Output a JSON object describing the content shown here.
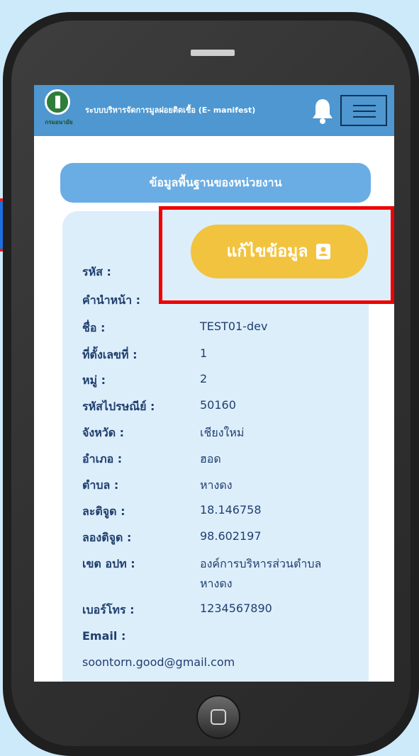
{
  "header": {
    "app_title": "ระบบบริหารจัดการมูลฝอยติดเชื้อ (E- manifest)",
    "logo_caption": "กรมอนามัย"
  },
  "section": {
    "title": "ข้อมูลพื้นฐานของหน่วยงาน"
  },
  "edit_button": {
    "label": "แก้ไขข้อมูล"
  },
  "fields": [
    {
      "label": "รหัส :",
      "value": ""
    },
    {
      "label": "คำนำหน้า :",
      "value": ""
    },
    {
      "label": "ชื่อ :",
      "value": "TEST01-dev"
    },
    {
      "label": "ที่ตั้งเลขที่ :",
      "value": "1"
    },
    {
      "label": "หมู่ :",
      "value": "2"
    },
    {
      "label": "รหัสไปรษณีย์ :",
      "value": "50160"
    },
    {
      "label": "จังหวัด :",
      "value": "เชียงใหม่"
    },
    {
      "label": "อำเภอ :",
      "value": "ฮอด"
    },
    {
      "label": "ตำบล :",
      "value": "หางดง"
    },
    {
      "label": "ละติจูด :",
      "value": "18.146758"
    },
    {
      "label": "ลองติจูด :",
      "value": "98.602197"
    },
    {
      "label": "เขต อปท :",
      "value": "องค์การบริหารส่วนตำบล",
      "value_line2": "หางดง"
    },
    {
      "label": "เบอร์โทร :",
      "value": "1234567890"
    },
    {
      "label": "Email :",
      "value": ""
    }
  ],
  "email_value": "soontorn.good@gmail.com",
  "colors": {
    "background": "#cdeafb",
    "topbar": "#4e97d0",
    "section_pill": "#6aade4",
    "content_box": "#ddeefb",
    "edit_button": "#f2c33e",
    "highlight": "#ee0202",
    "text": "#1f3f6e"
  },
  "icons": {
    "notification": "bell-icon",
    "menu": "hamburger-menu-icon",
    "edit": "contact-card-icon"
  }
}
